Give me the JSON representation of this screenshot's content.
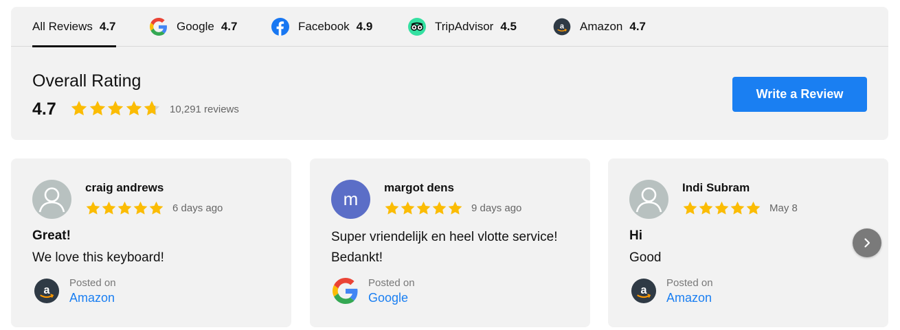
{
  "colors": {
    "accent": "#1a7ff2",
    "star": "#fbbc04",
    "panel_bg": "#f2f2f2",
    "avatar_letter_bg": "#5b6ec7",
    "avatar_silhouette_bg": "#b8c1c0"
  },
  "tabs": [
    {
      "label": "All Reviews",
      "score": "4.7",
      "icon": null,
      "active": true
    },
    {
      "label": "Google",
      "score": "4.7",
      "icon": "google-icon",
      "active": false
    },
    {
      "label": "Facebook",
      "score": "4.9",
      "icon": "facebook-icon",
      "active": false
    },
    {
      "label": "TripAdvisor",
      "score": "4.5",
      "icon": "tripadvisor-icon",
      "active": false
    },
    {
      "label": "Amazon",
      "score": "4.7",
      "icon": "amazon-icon",
      "active": false
    }
  ],
  "overall": {
    "title": "Overall Rating",
    "score": "4.7",
    "stars": 4.7,
    "count": "10,291  reviews",
    "write_button": "Write a Review"
  },
  "reviews": [
    {
      "name": "craig andrews",
      "avatar": "user-silhouette-icon",
      "stars": 5,
      "date": "6 days ago",
      "title": "Great!",
      "text": "We love this keyboard!",
      "posted_label": "Posted on",
      "source": "Amazon",
      "source_icon": "amazon-icon"
    },
    {
      "name": "margot dens",
      "avatar_letter": "m",
      "stars": 5,
      "date": "9 days ago",
      "text": "Super vriendelijk en heel vlotte service! Bedankt!",
      "posted_label": "Posted on",
      "source": "Google",
      "source_icon": "google-icon"
    },
    {
      "name": "Indi Subram",
      "avatar": "user-silhouette-icon",
      "stars": 5,
      "date": "May 8",
      "title": "Hi",
      "text": "Good",
      "posted_label": "Posted on",
      "source": "Amazon",
      "source_icon": "amazon-icon"
    }
  ],
  "carousel": {
    "next_icon": "chevron-right-icon"
  }
}
